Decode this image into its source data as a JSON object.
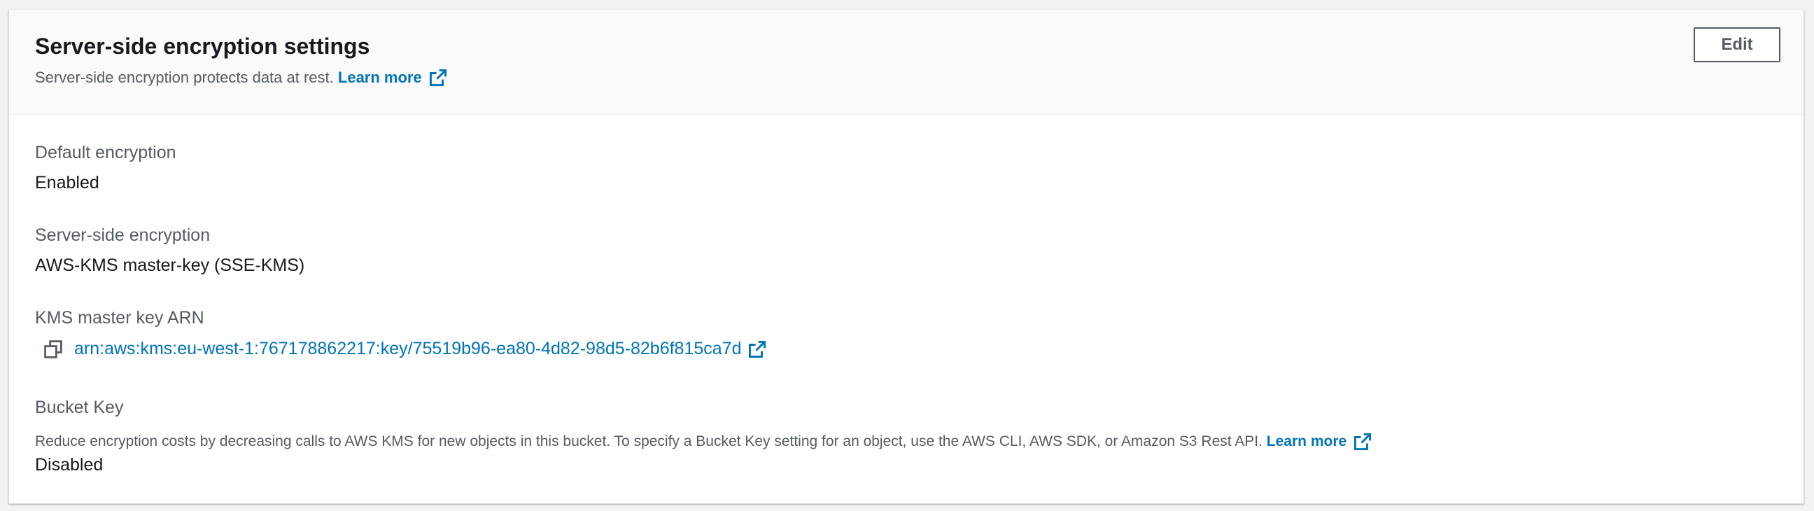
{
  "header": {
    "title": "Server-side encryption settings",
    "description": "Server-side encryption protects data at rest.",
    "learn_more": "Learn more",
    "edit_label": "Edit"
  },
  "fields": {
    "default_encryption": {
      "label": "Default encryption",
      "value": "Enabled"
    },
    "server_side_encryption": {
      "label": "Server-side encryption",
      "value": "AWS-KMS master-key (SSE-KMS)"
    },
    "kms_key_arn": {
      "label": "KMS master key ARN",
      "value": "arn:aws:kms:eu-west-1:767178862217:key/75519b96-ea80-4d82-98d5-82b6f815ca7d",
      "copy_icon": "copy-icon",
      "external_icon": "external-link-icon"
    },
    "bucket_key": {
      "label": "Bucket Key",
      "description": "Reduce encryption costs by decreasing calls to AWS KMS for new objects in this bucket. To specify a Bucket Key setting for an object, use the AWS CLI, AWS SDK, or Amazon S3 Rest API.",
      "learn_more": "Learn more",
      "value": "Disabled"
    }
  },
  "colors": {
    "link": "#0073bb",
    "text": "#16191f",
    "secondary_text": "#545b64",
    "header_bg": "#fafafa",
    "page_bg": "#f2f3f3"
  }
}
